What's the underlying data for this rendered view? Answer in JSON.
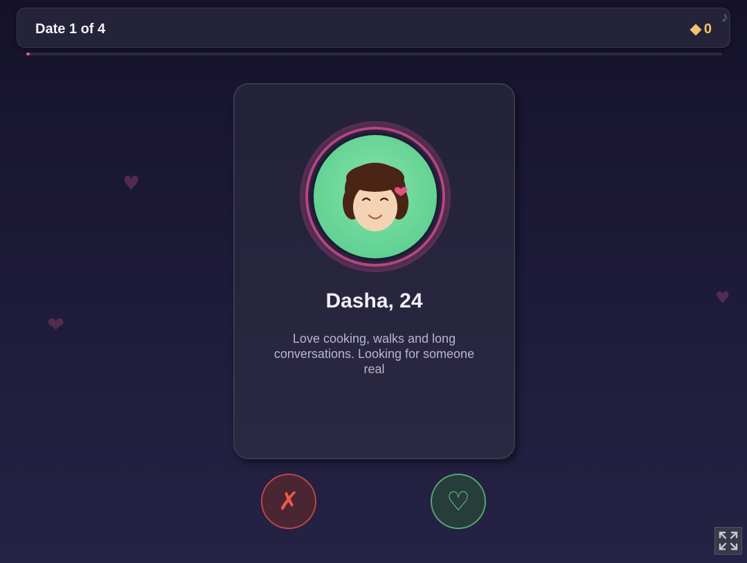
{
  "header": {
    "date_label": "Date 1 of 4",
    "gems": "0",
    "gem_icon": "diamond-icon",
    "music_icon": "music-note-icon"
  },
  "progress": {
    "fraction": 0.005,
    "color": "#e65c8a"
  },
  "profile": {
    "name": "Dasha, 24",
    "bio": "Love cooking, walks and long conversations. Looking for someone real",
    "avatar_bg": "#6fd99a",
    "ring_color": "#b8457e"
  },
  "actions": {
    "reject_symbol": "✗",
    "like_symbol": "♡"
  },
  "colors": {
    "reject": "#ec5a4c",
    "like": "#6bd08e",
    "gem": "#f2c46b"
  },
  "decor": {
    "heart_symbol": "♥",
    "heart_symbol_alt": "❤"
  }
}
